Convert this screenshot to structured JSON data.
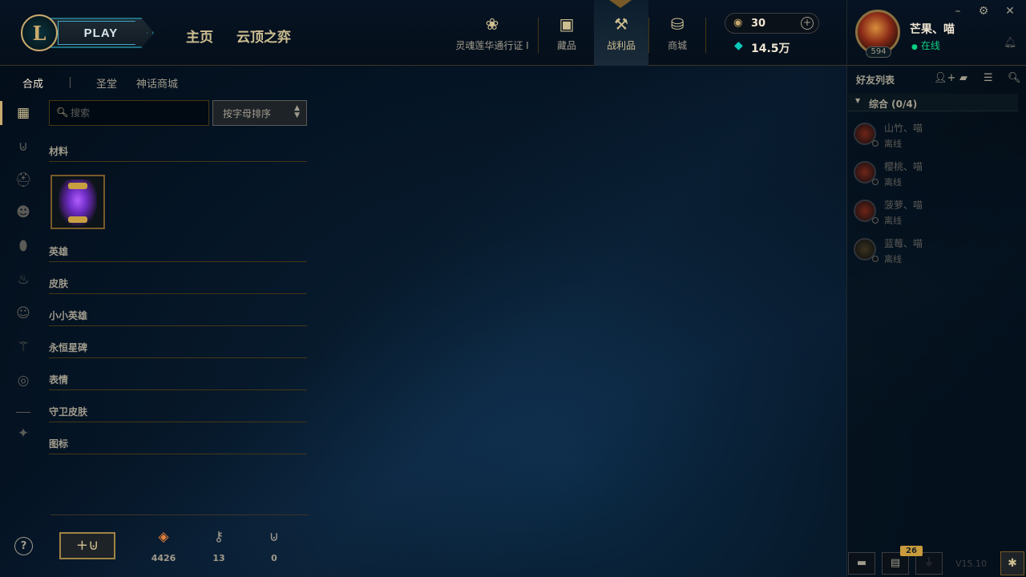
{
  "header": {
    "logo_text": "L",
    "play_label": "PLAY",
    "nav_home": "主页",
    "nav_tft": "云顶之弈",
    "icon_nav": [
      {
        "label": "灵魂莲华通行证 I",
        "icon": "lotus-icon"
      },
      {
        "label": "藏品",
        "icon": "collection-icon"
      },
      {
        "label": "战利品",
        "icon": "loot-icon",
        "active": true
      },
      {
        "label": "商城",
        "icon": "store-icon"
      }
    ],
    "rp_value": "30",
    "be_value": "14.5万"
  },
  "profile": {
    "name": "芒果、喵",
    "status": "在线",
    "level": "594"
  },
  "subtabs": [
    "合成",
    "圣堂",
    "神话商城"
  ],
  "search": {
    "placeholder": "搜索"
  },
  "sort": {
    "value": "按字母排序"
  },
  "sections": [
    "材料",
    "英雄",
    "皮肤",
    "小小英雄",
    "永恒星碑",
    "表情",
    "守卫皮肤",
    "图标"
  ],
  "bottom": {
    "orange_essence": "4426",
    "keys": "13",
    "chests": "0"
  },
  "friends": {
    "title": "好友列表",
    "group": "综合 (0/4)",
    "list": [
      {
        "name": "山竹、喵",
        "status": "离线"
      },
      {
        "name": "樱桃、喵",
        "status": "离线"
      },
      {
        "name": "菠萝、喵",
        "status": "离线"
      },
      {
        "name": "蓝莓、喵",
        "status": "离线"
      }
    ]
  },
  "social": {
    "chat_badge": "26",
    "version": "V15.10"
  },
  "colors": {
    "gold": "#c8aa6e",
    "online": "#0acf83",
    "background": "#010a13"
  }
}
